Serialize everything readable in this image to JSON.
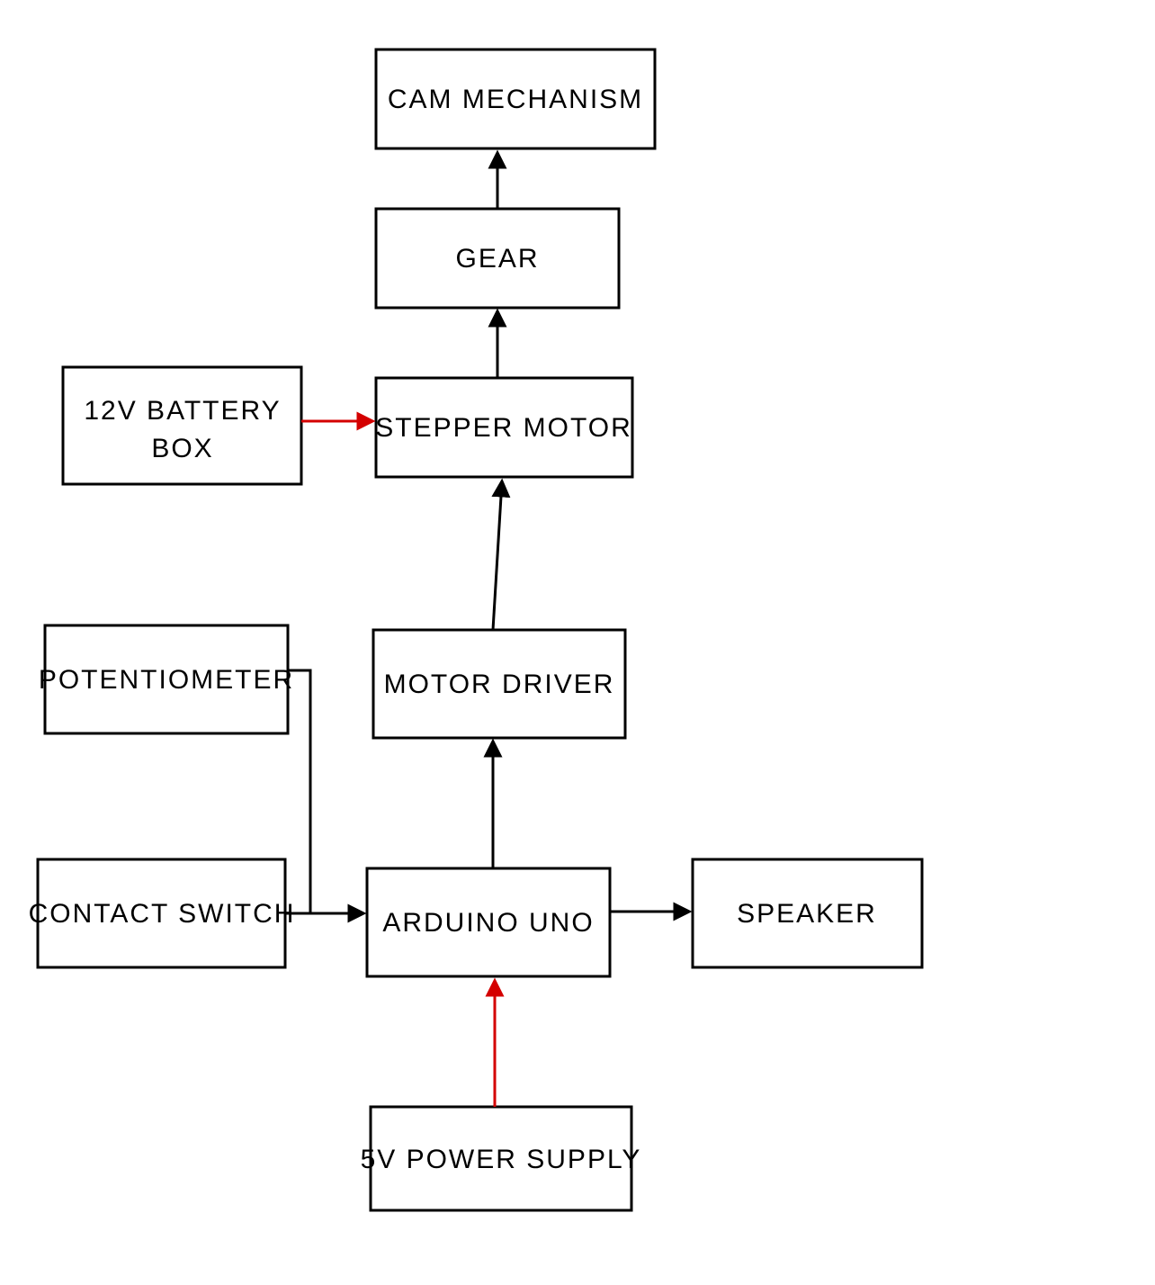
{
  "nodes": {
    "cam": {
      "label": "CAM  MECHANISM"
    },
    "gear": {
      "label": "GEAR"
    },
    "stepper": {
      "label": "STEPPER  MOTOR"
    },
    "driver": {
      "label": "MOTOR  DRIVER"
    },
    "arduino": {
      "label": "ARDUINO  UNO"
    },
    "psu": {
      "label": "5V  POWER  SUPPLY"
    },
    "battery_l1": {
      "label": "12V  BATTERY"
    },
    "battery_l2": {
      "label": "BOX"
    },
    "potentiometer": {
      "label": "POTENTIOMETER"
    },
    "contact": {
      "label": "CONTACT  SWITCH"
    },
    "speaker": {
      "label": "SPEAKER"
    }
  },
  "edges": [
    {
      "from": "gear",
      "to": "cam",
      "color": "black"
    },
    {
      "from": "stepper",
      "to": "gear",
      "color": "black"
    },
    {
      "from": "driver",
      "to": "stepper",
      "color": "black"
    },
    {
      "from": "arduino",
      "to": "driver",
      "color": "black"
    },
    {
      "from": "contact",
      "to": "arduino",
      "color": "black"
    },
    {
      "from": "potentiometer",
      "to": "arduino",
      "color": "black"
    },
    {
      "from": "arduino",
      "to": "speaker",
      "color": "black"
    },
    {
      "from": "battery",
      "to": "stepper",
      "color": "red"
    },
    {
      "from": "psu",
      "to": "arduino",
      "color": "red"
    }
  ],
  "colors": {
    "black": "#000000",
    "red": "#d40000"
  }
}
